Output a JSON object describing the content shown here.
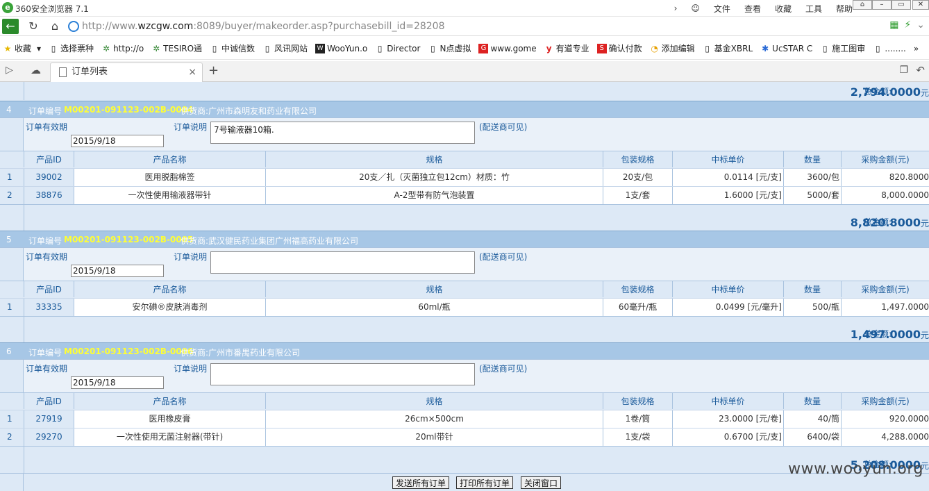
{
  "browser": {
    "title": "360安全浏览器 7.1",
    "menus": [
      "文件",
      "查看",
      "收藏",
      "工具",
      "帮助"
    ],
    "url_prefix": "http://www.",
    "url_host": "wzcgw.com",
    "url_rest": ":8089/buyer/makeorder.asp?purchasebill_id=28208",
    "bookmarks": [
      "收藏",
      "选择票种",
      "http://o",
      "TESIRO通",
      "中诚信数",
      "风讯网站",
      "WooYun.o",
      "Director",
      "N点虚拟",
      "www.gome",
      "有道专业",
      "确认付款",
      "添加编辑",
      "基金XBRL",
      "UcSTAR C",
      "施工图审",
      "........"
    ],
    "tab_title": "订单列表"
  },
  "labels": {
    "order_no": "订单编号",
    "supplier_prefix": "供货商:",
    "valid_date": "订单有效期",
    "remark": "订单说明",
    "visible": "(配送商可见)",
    "total": "总金额:",
    "unit": "元"
  },
  "columns": [
    "产品ID",
    "产品名称",
    "规格",
    "包装规格",
    "中标单价",
    "数量",
    "采购金额(元)"
  ],
  "top_total": "2,794.0000",
  "orders": [
    {
      "idx": "4",
      "order_no": "M00201-091123-002B-0004",
      "supplier": "广州市森明友和药业有限公司",
      "date": "2015/9/18",
      "remark": "7号输液器10箱.",
      "rows": [
        {
          "n": "1",
          "id": "39002",
          "name": "医用脱脂棉签",
          "spec": "20支／扎（灭菌独立包12cm）材质：竹",
          "pack": "20支/包",
          "price": "0.0114 [元/支]",
          "qty": "3600/包",
          "amount": "820.8000"
        },
        {
          "n": "2",
          "id": "38876",
          "name": "一次性使用输液器带针",
          "spec": "A-2型带有防气泡装置",
          "pack": "1支/套",
          "price": "1.6000 [元/支]",
          "qty": "5000/套",
          "amount": "8,000.0000"
        }
      ],
      "total": "8,820.8000"
    },
    {
      "idx": "5",
      "order_no": "M00201-091123-002B-0005",
      "supplier": "武汉健民药业集团广州福高药业有限公司",
      "date": "2015/9/18",
      "remark": "",
      "rows": [
        {
          "n": "1",
          "id": "33335",
          "name": "安尔碘®皮肤消毒剂",
          "spec": "60ml/瓶",
          "pack": "60毫升/瓶",
          "price": "0.0499 [元/毫升]",
          "qty": "500/瓶",
          "amount": "1,497.0000"
        }
      ],
      "total": "1,497.0000"
    },
    {
      "idx": "6",
      "order_no": "M00201-091123-002B-0006",
      "supplier": "广州市番禺药业有限公司",
      "date": "2015/9/18",
      "remark": "",
      "rows": [
        {
          "n": "1",
          "id": "27919",
          "name": "医用橡皮膏",
          "spec": "26cm×500cm",
          "pack": "1卷/筒",
          "price": "23.0000 [元/卷]",
          "qty": "40/筒",
          "amount": "920.0000"
        },
        {
          "n": "2",
          "id": "29270",
          "name": "一次性使用无菌注射器(带针)",
          "spec": "20ml带针",
          "pack": "1支/袋",
          "price": "0.6700 [元/支]",
          "qty": "6400/袋",
          "amount": "4,288.0000"
        }
      ],
      "total": "5,208.0000"
    }
  ],
  "buttons": {
    "send_all": "发送所有订单",
    "print_all": "打印所有订单",
    "close": "关闭窗口"
  },
  "watermark": "www.wooyun.org"
}
